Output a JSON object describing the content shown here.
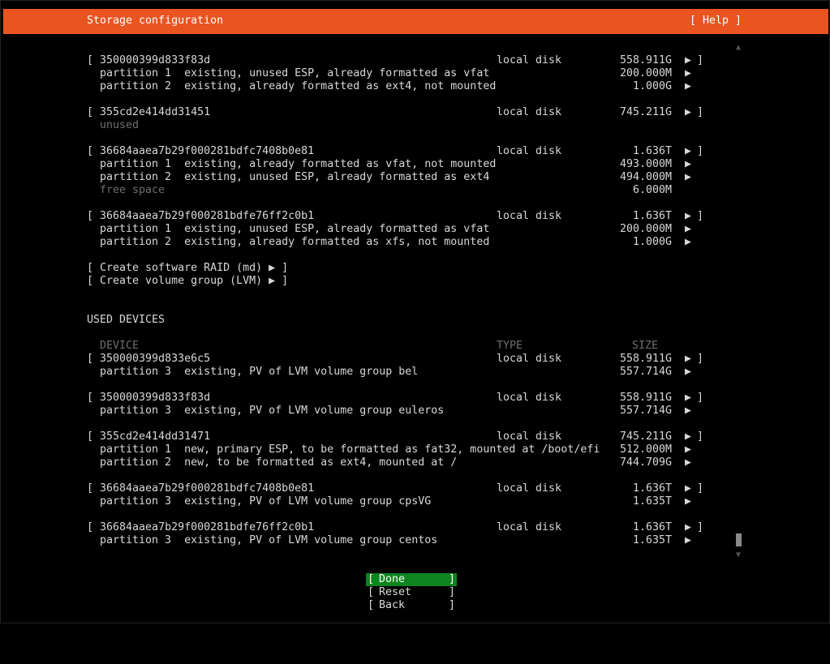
{
  "header": {
    "title": "Storage configuration",
    "help": "[ Help ]"
  },
  "available": {
    "disks": [
      {
        "name": "[ 350000399d833f83d",
        "type": "local disk",
        "size": "558.911G",
        "rows": [
          {
            "text": "partition 1  existing, unused ESP, already formatted as vfat",
            "size": "200.000M",
            "arrow": true
          },
          {
            "text": "partition 2  existing, already formatted as ext4, not mounted",
            "size": "1.000G",
            "arrow": true
          }
        ]
      },
      {
        "name": "[ 355cd2e414dd31451",
        "type": "local disk",
        "size": "745.211G",
        "rows": [
          {
            "text": "unused",
            "size": "",
            "arrow": false,
            "dim": true
          }
        ]
      },
      {
        "name": "[ 36684aaea7b29f000281bdfc7408b0e81",
        "type": "local disk",
        "size": "1.636T",
        "rows": [
          {
            "text": "partition 1  existing, already formatted as vfat, not mounted",
            "size": "493.000M",
            "arrow": true
          },
          {
            "text": "partition 2  existing, unused ESP, already formatted as ext4",
            "size": "494.000M",
            "arrow": true
          },
          {
            "text": "free space",
            "size": "6.000M",
            "arrow": false,
            "dim": true
          }
        ]
      },
      {
        "name": "[ 36684aaea7b29f000281bdfe76ff2c0b1",
        "type": "local disk",
        "size": "1.636T",
        "rows": [
          {
            "text": "partition 1  existing, unused ESP, already formatted as vfat",
            "size": "200.000M",
            "arrow": true
          },
          {
            "text": "partition 2  existing, already formatted as xfs, not mounted",
            "size": "1.000G",
            "arrow": true
          }
        ]
      }
    ],
    "actions": [
      "[ Create software RAID (md) ▶ ]",
      "[ Create volume group (LVM) ▶ ]"
    ]
  },
  "used": {
    "heading": "USED DEVICES",
    "col_device": "DEVICE",
    "col_type": "TYPE",
    "col_size": "SIZE",
    "disks": [
      {
        "name": "[ 350000399d833e6c5",
        "type": "local disk",
        "size": "558.911G",
        "rows": [
          {
            "text": "partition 3  existing, PV of LVM volume group bel",
            "size": "557.714G",
            "arrow": true
          }
        ]
      },
      {
        "name": "[ 350000399d833f83d",
        "type": "local disk",
        "size": "558.911G",
        "rows": [
          {
            "text": "partition 3  existing, PV of LVM volume group euleros",
            "size": "557.714G",
            "arrow": true
          }
        ]
      },
      {
        "name": "[ 355cd2e414dd31471",
        "type": "local disk",
        "size": "745.211G",
        "rows": [
          {
            "text": "partition 1  new, primary ESP, to be formatted as fat32, mounted at /boot/efi",
            "size": "512.000M",
            "arrow": true
          },
          {
            "text": "partition 2  new, to be formatted as ext4, mounted at /",
            "size": "744.709G",
            "arrow": true
          }
        ]
      },
      {
        "name": "[ 36684aaea7b29f000281bdfc7408b0e81",
        "type": "local disk",
        "size": "1.636T",
        "rows": [
          {
            "text": "partition 3  existing, PV of LVM volume group cpsVG",
            "size": "1.635T",
            "arrow": true
          }
        ]
      },
      {
        "name": "[ 36684aaea7b29f000281bdfe76ff2c0b1",
        "type": "local disk",
        "size": "1.636T",
        "rows": [
          {
            "text": "partition 3  existing, PV of LVM volume group centos",
            "size": "1.635T",
            "arrow": true
          }
        ]
      }
    ]
  },
  "glyphs": {
    "arrow": "▶",
    "close_bracket": "]",
    "scroll_up": "▲",
    "scroll_down": "▼"
  },
  "buttons": {
    "done": "Done",
    "reset": "Reset",
    "back": "Back",
    "open": "[",
    "close": "]"
  },
  "colors": {
    "accent": "#e95420",
    "selected": "#0e8420"
  }
}
